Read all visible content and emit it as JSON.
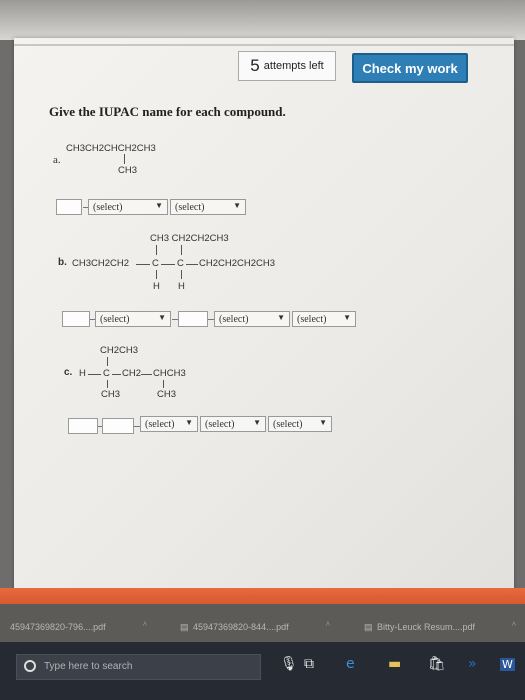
{
  "header": {
    "attempts_count": "5",
    "attempts_label": "attempts left",
    "check_button": "Check my work"
  },
  "question": {
    "heading": "Give the IUPAC name for each compound."
  },
  "part_a": {
    "label": "a.",
    "main_chain": "CH3CH2CHCH2CH3",
    "branch": "CH3",
    "selects": [
      "(select)",
      "(select)"
    ]
  },
  "part_b": {
    "label": "b.",
    "top_groups": "CH3 CH2CH2CH3",
    "main_chain_left": "CH3CH2CH2",
    "carbon_1": "C",
    "carbon_2": "C",
    "main_chain_right": "CH2CH2CH2CH3",
    "bottom_h1": "H",
    "bottom_h2": "H",
    "selects": [
      "(select)",
      "(select)",
      "(select)"
    ]
  },
  "part_c": {
    "label": "c.",
    "top_group": "CH2CH3",
    "h_atom": "H",
    "carbon": "C",
    "middle": "CH2",
    "right_group": "CHCH3",
    "bottom_left": "CH3",
    "bottom_right": "CH3",
    "selects": [
      "(select)",
      "(select)",
      "(select)"
    ]
  },
  "downloads": [
    {
      "name": "45947369820-796....pdf"
    },
    {
      "name": "45947369820-844....pdf"
    },
    {
      "name": "Bitty-Leuck Resum....pdf"
    }
  ],
  "taskbar": {
    "search_placeholder": "Type here to search"
  }
}
